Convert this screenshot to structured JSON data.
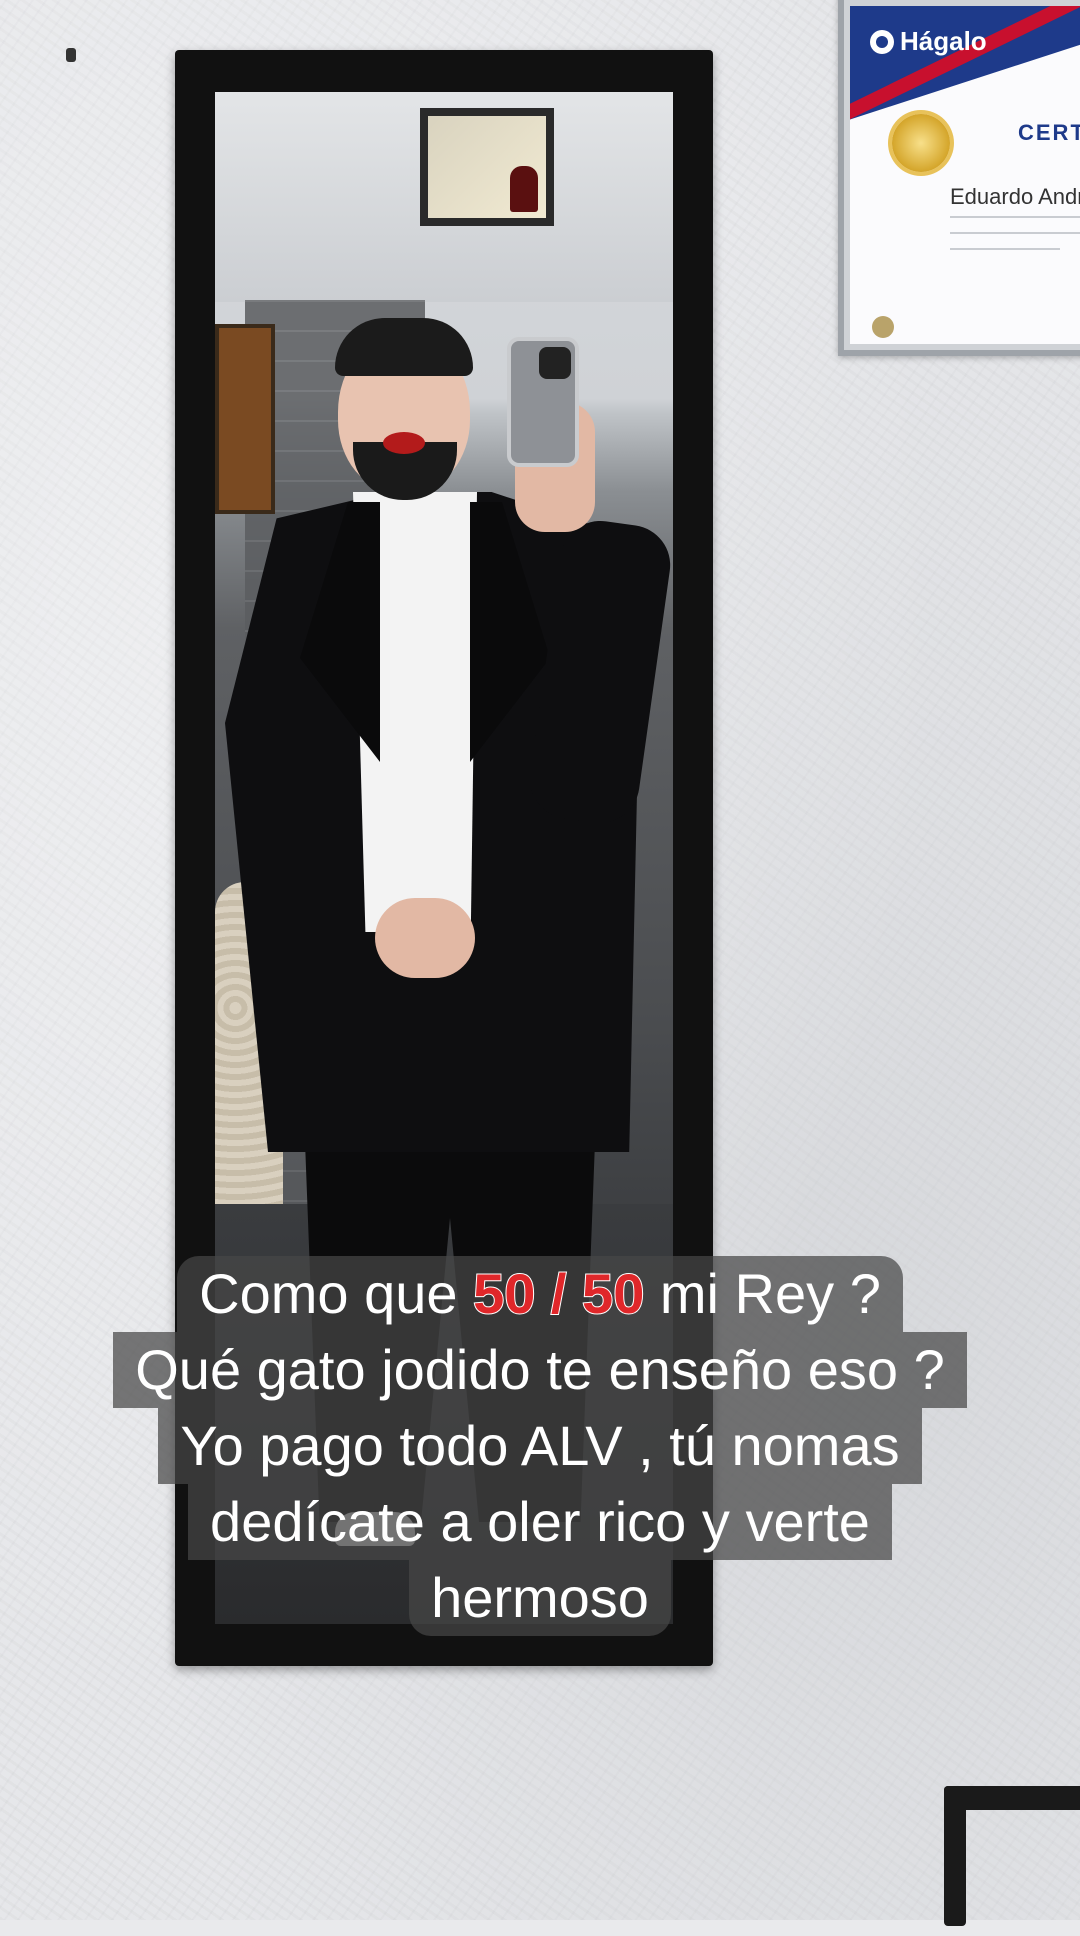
{
  "certificate": {
    "logo_text": "Hágalo",
    "title": "CERTI",
    "name": "Eduardo Andre"
  },
  "caption": {
    "line1_pre": "Como que ",
    "line1_highlight": "50 / 50",
    "line1_post": " mi Rey ?",
    "line2": "Qué gato jodido te enseño eso ?",
    "line3": "Yo pago todo ALV , tú nomas",
    "line4": "dedícate a oler rico y verte",
    "line5": "hermoso",
    "highlight_color": "#e0272a"
  }
}
